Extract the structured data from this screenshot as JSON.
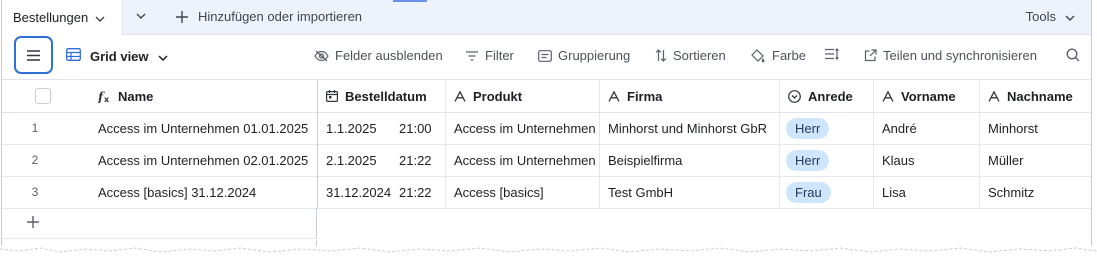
{
  "tabbar": {
    "active_tab": "Bestellungen",
    "add_import_label": "Hinzufügen oder importieren",
    "tools_label": "Tools"
  },
  "toolbar": {
    "view_name": "Grid view",
    "hide_fields": "Felder ausblenden",
    "filter": "Filter",
    "group": "Gruppierung",
    "sort": "Sortieren",
    "color": "Farbe",
    "share_sync": "Teilen und synchronisieren"
  },
  "columns": {
    "name": "Name",
    "date": "Bestelldatum",
    "product": "Produkt",
    "company": "Firma",
    "salutation": "Anrede",
    "firstname": "Vorname",
    "lastname": "Nachname"
  },
  "rows": [
    {
      "num": "1",
      "name": "Access im Unternehmen 01.01.2025",
      "date": "1.1.2025",
      "time": "21:00",
      "product": "Access im Unternehmen",
      "company": "Minhorst und Minhorst GbR",
      "salutation": "Herr",
      "firstname": "André",
      "lastname": "Minhorst"
    },
    {
      "num": "2",
      "name": "Access im Unternehmen 02.01.2025",
      "date": "2.1.2025",
      "time": "21:22",
      "product": "Access im Unternehmen",
      "company": "Beispielfirma",
      "salutation": "Herr",
      "firstname": "Klaus",
      "lastname": "Müller"
    },
    {
      "num": "3",
      "name": "Access [basics] 31.12.2024",
      "date": "31.12.2024",
      "time": "21:22",
      "product": "Access [basics]",
      "company": "Test GmbH",
      "salutation": "Frau",
      "firstname": "Lisa",
      "lastname": "Schmitz"
    }
  ],
  "colors": {
    "accent": "#2f6fd8",
    "pill": "#cfe5fb",
    "tabbar_bg": "#eef2fb"
  }
}
